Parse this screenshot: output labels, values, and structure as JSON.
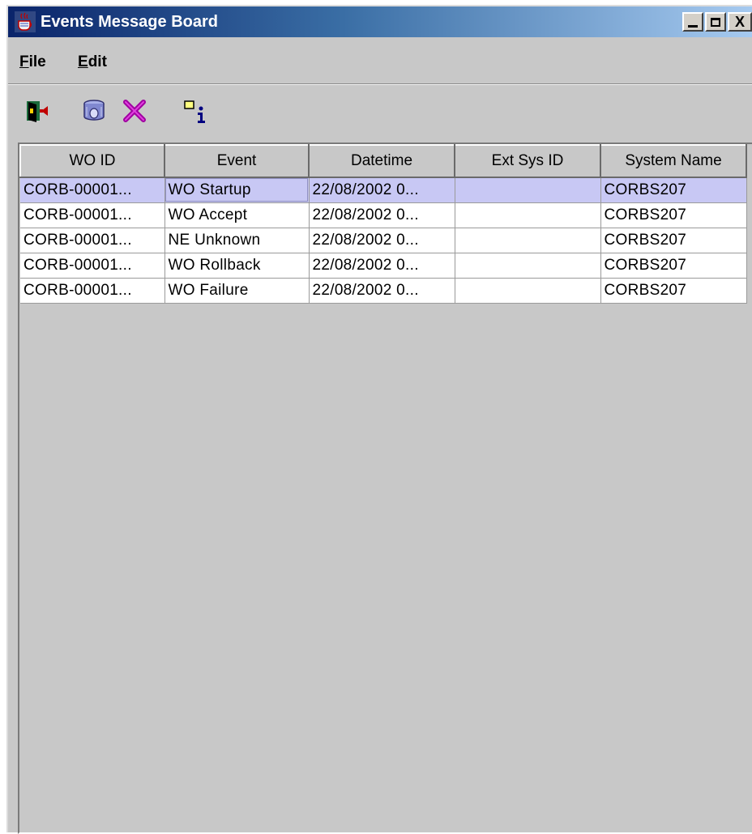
{
  "window": {
    "title": "Events Message Board",
    "controls": {
      "minimize": "_",
      "close": "X"
    }
  },
  "menu": [
    {
      "mnemonic": "F",
      "rest": "ile"
    },
    {
      "mnemonic": "E",
      "rest": "dit"
    }
  ],
  "toolbar": [
    {
      "icon": "exit-door-icon"
    },
    {
      "icon": "clear-filter-icon"
    },
    {
      "icon": "delete-x-icon"
    },
    {
      "icon": "info-icon"
    }
  ],
  "table": {
    "columns": [
      "WO ID",
      "Event",
      "Datetime",
      "Ext Sys ID",
      "System Name"
    ],
    "rows": [
      [
        "CORB-00001...",
        "WO Startup",
        "22/08/2002 0...",
        "",
        "CORBS207"
      ],
      [
        "CORB-00001...",
        "WO Accept",
        "22/08/2002 0...",
        "",
        "CORBS207"
      ],
      [
        "CORB-00001...",
        "NE Unknown",
        "22/08/2002 0...",
        "",
        "CORBS207"
      ],
      [
        "CORB-00001...",
        "WO Rollback",
        "22/08/2002 0...",
        "",
        "CORBS207"
      ],
      [
        "CORB-00001...",
        "WO Failure",
        "22/08/2002 0...",
        "",
        "CORBS207"
      ]
    ],
    "selected_row": 0
  },
  "colors": {
    "titlebar_start": "#0a246a",
    "titlebar_end": "#a6caf0",
    "panel": "#c8c8c8",
    "selection": "#c8c8f4"
  }
}
